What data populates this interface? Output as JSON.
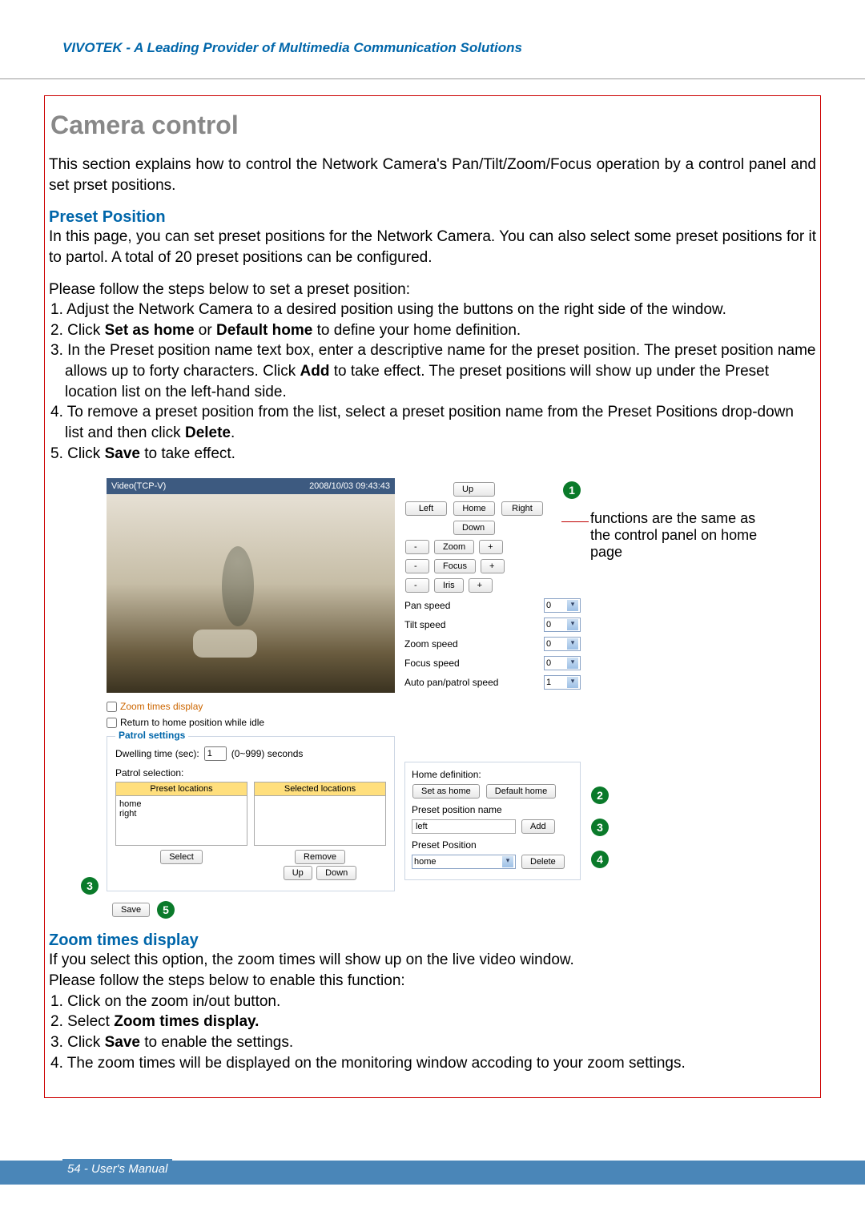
{
  "header": {
    "brand_line": "VIVOTEK - A Leading Provider of Multimedia Communication Solutions"
  },
  "title": "Camera control",
  "intro": "This section explains how to control the Network Camera's Pan/Tilt/Zoom/Focus operation by a control panel and set prset positions.",
  "section1": {
    "heading": "Preset Position",
    "p1": "In this page, you can set preset positions for the Network Camera. You can also select some preset positions for it to partol. A total of 20 preset positions can be configured.",
    "steps_intro": "Please follow the steps below to set a preset position:",
    "steps": [
      "1. Adjust the Network Camera to a desired position using the buttons on the right side of the window.",
      "2. Click Set as home or Default home to define your home definition.",
      "3. In the Preset position name text box, enter a descriptive name for the preset position. The preset position name allows up to forty characters. Click Add to take effect. The preset positions will show up under the Preset location list on the left-hand side.",
      "4. To remove a preset position from the list, select a preset position name from the Preset Positions drop-down list and then click Delete.",
      "5. Click Save to take effect."
    ]
  },
  "section2": {
    "heading": "Zoom times display",
    "p1": "If you select this option, the zoom times will show up on the live video window.",
    "p2": "Please follow the steps below to enable this function:",
    "steps": [
      "1. Click on the zoom in/out button.",
      "2. Select Zoom times display.",
      "3. Click Save to enable the settings.",
      "4. The zoom times will be displayed on the monitoring window accoding to your zoom settings."
    ]
  },
  "mockup": {
    "video_source_label": "Video(TCP-V)",
    "timestamp": "2008/10/03 09:43:43",
    "zoom_times_display_label": "Zoom times display",
    "return_home_label": "Return to home position while idle",
    "patrol": {
      "legend": "Patrol settings",
      "dwell_label": "Dwelling time (sec):",
      "dwell_value": "1",
      "dwell_hint": "(0~999) seconds",
      "patrol_sel_label": "Patrol selection:",
      "preset_header": "Preset locations",
      "selected_header": "Selected locations",
      "preset_items": [
        "home",
        "right"
      ],
      "btn_select": "Select",
      "btn_remove": "Remove",
      "btn_up": "Up",
      "btn_down": "Down"
    },
    "save_label": "Save",
    "controls": {
      "up": "Up",
      "left": "Left",
      "home": "Home",
      "right": "Right",
      "down": "Down",
      "zoom": "Zoom",
      "focus": "Focus",
      "iris": "Iris",
      "minus": "-",
      "plus": "+",
      "pan_speed_label": "Pan speed",
      "pan_speed_val": "0",
      "tilt_speed_label": "Tilt speed",
      "tilt_speed_val": "0",
      "zoom_speed_label": "Zoom speed",
      "zoom_speed_val": "0",
      "focus_speed_label": "Focus speed",
      "focus_speed_val": "0",
      "auto_speed_label": "Auto pan/patrol speed",
      "auto_speed_val": "1"
    },
    "homedef": {
      "legend": "Home definition:",
      "set_as_home": "Set as home",
      "default_home": "Default home",
      "preset_name_label": "Preset position name",
      "preset_name_value": "left",
      "add": "Add",
      "preset_position_label": "Preset Position",
      "preset_position_value": "home",
      "delete": "Delete"
    },
    "annot_text": "functions are the same as the control panel on  home page",
    "badges": {
      "b1": "1",
      "b2": "2",
      "b3": "3",
      "b3b": "3",
      "b4": "4",
      "b5": "5"
    }
  },
  "footer": "54 - User's Manual"
}
